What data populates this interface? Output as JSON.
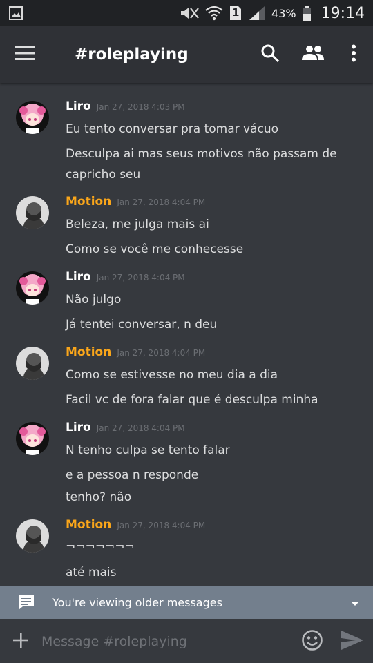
{
  "status_bar": {
    "battery": "43%",
    "time": "19:14",
    "sim_slot": "1",
    "icons": [
      "gallery-icon",
      "mute-icon",
      "wifi-icon",
      "sim-icon",
      "signal-icon",
      "battery-icon"
    ]
  },
  "header": {
    "channel_title": "#roleplaying",
    "icons": [
      "menu-icon",
      "search-icon",
      "members-icon",
      "more-icon"
    ]
  },
  "messages": [
    {
      "author": "Liro",
      "timestamp": "Jan 27, 2018 4:03 PM",
      "lines": [
        "Eu tento conversar pra tomar vácuo",
        "Desculpa ai mas seus motivos não passam de capricho seu"
      ]
    },
    {
      "author": "Motion",
      "timestamp": "Jan 27, 2018 4:04 PM",
      "lines": [
        "Beleza, me julga mais ai",
        "Como se você me conhecesse"
      ]
    },
    {
      "author": "Liro",
      "timestamp": "Jan 27, 2018 4:04 PM",
      "lines": [
        "Não julgo",
        "Já tentei conversar, n deu"
      ]
    },
    {
      "author": "Motion",
      "timestamp": "Jan 27, 2018 4:04 PM",
      "lines": [
        "Como se estivesse no meu dia a dia",
        "Facil vc de fora falar que é desculpa minha"
      ]
    },
    {
      "author": "Liro",
      "timestamp": "Jan 27, 2018 4:04 PM",
      "lines": [
        "N tenho culpa se tento falar",
        "e a pessoa n responde",
        "tenho? não"
      ]
    },
    {
      "author": "Motion",
      "timestamp": "Jan 27, 2018 4:04 PM",
      "lines": [
        "¬¬¬¬¬¬¬",
        "até mais"
      ]
    }
  ],
  "older_banner": {
    "text": "You're viewing older messages"
  },
  "composer": {
    "placeholder": "Message #roleplaying"
  },
  "colors": {
    "background": "#36393e",
    "header": "#2f3136",
    "status_bar": "#202225",
    "author_liro": "#ffffff",
    "author_motion": "#faa61a",
    "banner": "#737f8d"
  }
}
